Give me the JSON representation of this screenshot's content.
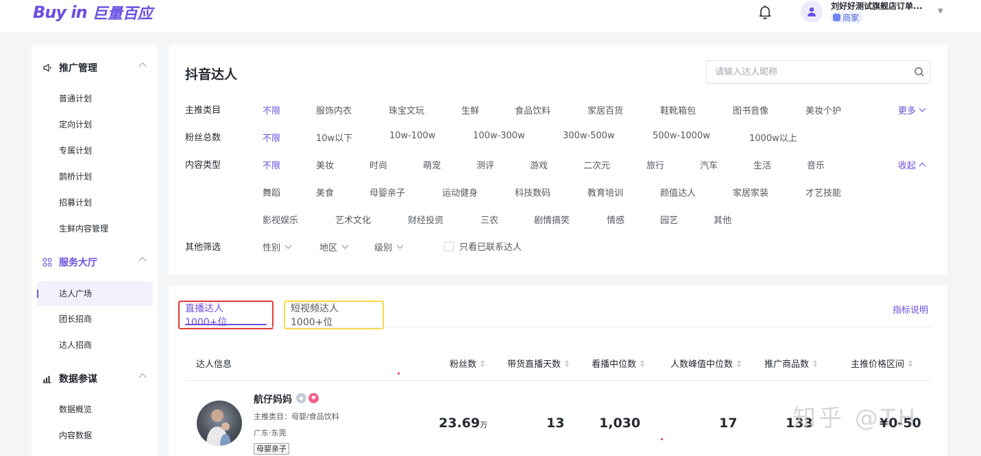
{
  "brand": {
    "logo_en": "Buy in",
    "logo_cn": "巨量百应"
  },
  "header": {
    "store_name": "刘好好测试旗舰店订单...",
    "role": "商家"
  },
  "sidebar": {
    "sections": [
      {
        "label": "推广管理",
        "icon": "megaphone-icon",
        "items": [
          "普通计划",
          "定向计划",
          "专属计划",
          "鹊桥计划",
          "招募计划",
          "生鲜内容管理"
        ]
      },
      {
        "label": "服务大厅",
        "icon": "grid-icon",
        "items": [
          "达人广场",
          "团长招商",
          "达人招商"
        ]
      },
      {
        "label": "数据参谋",
        "icon": "bar-chart-icon",
        "items": [
          "数据概览",
          "内容数据"
        ]
      }
    ],
    "active_item": "达人广场"
  },
  "filters": {
    "title": "抖音达人",
    "search_placeholder": "请输入达人昵称",
    "main_category": {
      "label": "主推类目",
      "options": [
        "不限",
        "服饰内衣",
        "珠宝文玩",
        "生鲜",
        "食品饮料",
        "家居百货",
        "鞋靴箱包",
        "图书音像",
        "美妆个护"
      ],
      "more": "更多"
    },
    "fans": {
      "label": "粉丝总数",
      "options": [
        "不限",
        "10w以下",
        "10w-100w",
        "100w-300w",
        "300w-500w",
        "500w-1000w",
        "1000w以上"
      ]
    },
    "content_type": {
      "label": "内容类型",
      "options_row1": [
        "不限",
        "美妆",
        "时尚",
        "萌宠",
        "测评",
        "游戏",
        "二次元",
        "旅行",
        "汽车",
        "生活",
        "音乐"
      ],
      "options_row2": [
        "舞蹈",
        "美食",
        "母婴亲子",
        "运动健身",
        "科技数码",
        "教育培训",
        "颜值达人",
        "家居家装",
        "才艺技能"
      ],
      "options_row3": [
        "影视娱乐",
        "艺术文化",
        "财经投资",
        "三农",
        "剧情搞笑",
        "情感",
        "园艺",
        "其他"
      ],
      "collapse": "收起"
    },
    "other": {
      "label": "其他筛选",
      "gender": "性别",
      "region": "地区",
      "level": "级别",
      "contacted_only": "只看已联系达人"
    }
  },
  "list": {
    "tabs": [
      "直播达人 1000+位",
      "短视频达人 1000+位"
    ],
    "metric_link": "指标说明",
    "columns": [
      "达人信息",
      "粉丝数",
      "带货直播天数",
      "看播中位数",
      "人数峰值中位数",
      "推广商品数",
      "主推价格区间"
    ],
    "rows": [
      {
        "name": "航仔妈妈",
        "main_category": "主推类目：母婴/食品饮料",
        "location": "广东·东莞",
        "tag": "母婴亲子",
        "fans": "23.69",
        "fans_unit": "万",
        "live_days": "13",
        "view_median": "1,030",
        "peak_median": "17",
        "products": "133",
        "price_range": "¥0-50"
      }
    ]
  },
  "watermark": "知乎 @TH"
}
